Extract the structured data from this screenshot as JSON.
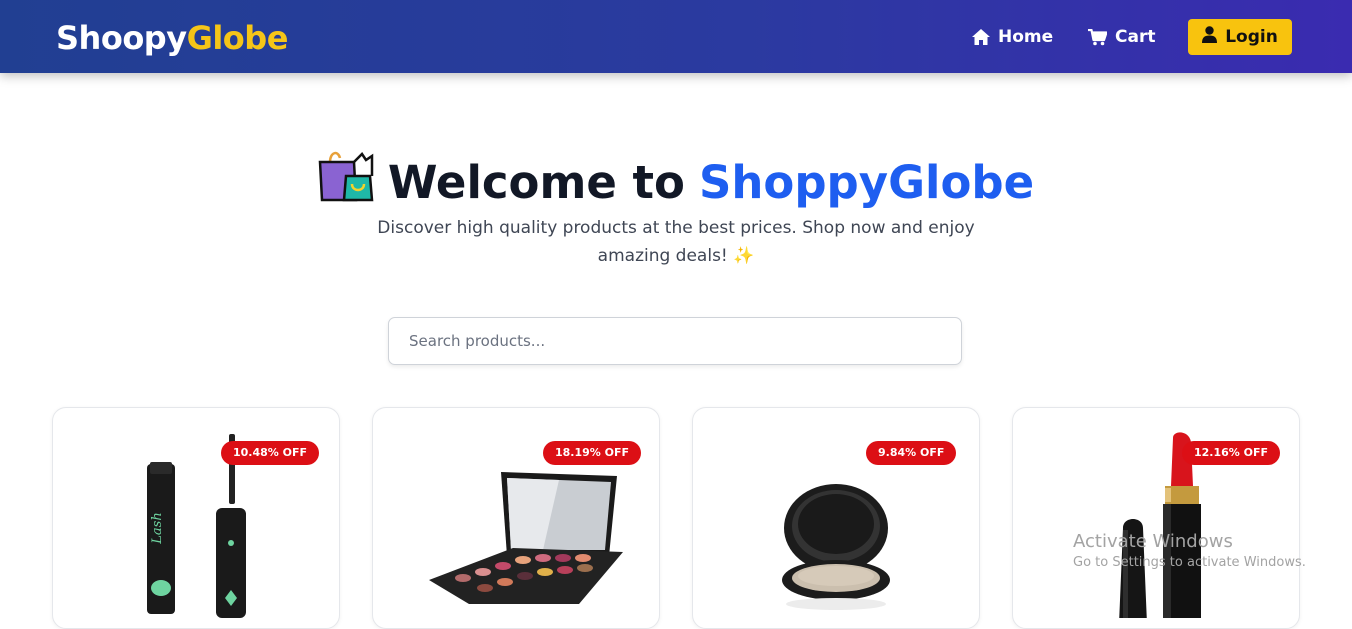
{
  "navbar": {
    "logo_part1": "Shoopy",
    "logo_part2": "Globe",
    "links": [
      {
        "label": "Home",
        "icon": "home-icon"
      },
      {
        "label": "Cart",
        "icon": "cart-icon"
      }
    ],
    "login_label": "Login",
    "login_icon": "user-icon",
    "colors": {
      "bar": "#2b3aa0",
      "accent": "#f8c30e"
    }
  },
  "hero": {
    "title_prefix": "Welcome to",
    "title_brand": "ShoppyGlobe",
    "subtitle": "Discover high quality products at the best prices. Shop now and enjoy amazing deals! ✨",
    "icon": "shopping-bags-icon",
    "brand_color": "#1e5ef0"
  },
  "search": {
    "placeholder": "Search products...",
    "value": ""
  },
  "products": [
    {
      "discount": "10.48% OFF",
      "image": "mascara"
    },
    {
      "discount": "18.19% OFF",
      "image": "eyeshadow-palette"
    },
    {
      "discount": "9.84% OFF",
      "image": "powder-compact"
    },
    {
      "discount": "12.16% OFF",
      "image": "lipstick"
    }
  ],
  "watermark": {
    "line1": "Activate Windows",
    "line2": "Go to Settings to activate Windows."
  }
}
